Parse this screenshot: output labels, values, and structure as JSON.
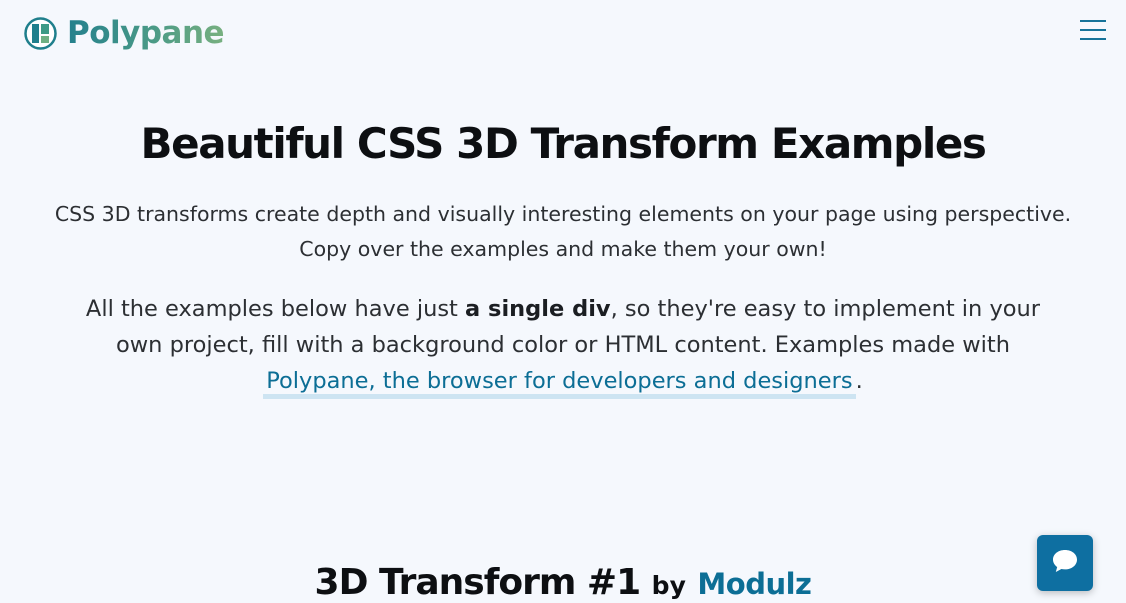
{
  "header": {
    "brand": "Polypane",
    "logo_icon": "polypane-logo-icon",
    "menu_icon": "hamburger-menu-icon"
  },
  "hero": {
    "title": "Beautiful CSS 3D Transform Examples",
    "intro_line1": "CSS 3D transforms create depth and visually interesting elements on your page using perspective.",
    "intro_line2": "Copy over the examples and make them your own!",
    "body_before": "All the examples below have just ",
    "body_bold": "a single div",
    "body_middle": ", so they're easy to implement in your own project, fill with a background color or HTML content. Examples made with ",
    "body_link": "Polypane, the browser for developers and designers",
    "body_after": "."
  },
  "section": {
    "title": "3D Transform #1",
    "by": "by",
    "author": "Modulz"
  },
  "chat": {
    "icon": "chat-bubble-icon"
  },
  "colors": {
    "background": "#f5f8fd",
    "accent": "#0e6fa1",
    "link": "#0c6e95",
    "link_underline": "#cde4f2"
  }
}
